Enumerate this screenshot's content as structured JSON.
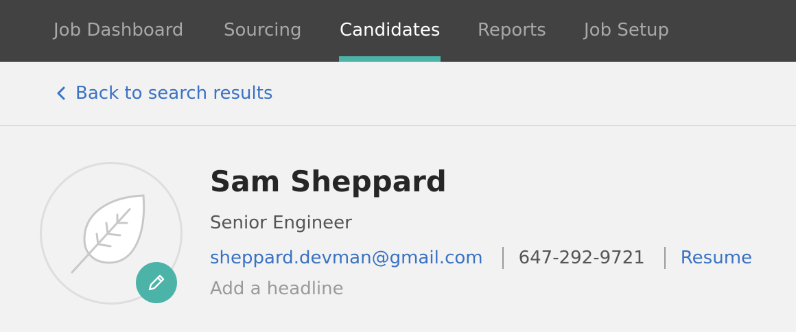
{
  "nav": {
    "tabs": [
      {
        "label": "Job Dashboard"
      },
      {
        "label": "Sourcing"
      },
      {
        "label": "Candidates",
        "active": true
      },
      {
        "label": "Reports"
      },
      {
        "label": "Job Setup"
      }
    ]
  },
  "back_link": {
    "label": "Back to search results",
    "icon": "chevron-left-icon"
  },
  "candidate": {
    "name": "Sam Sheppard",
    "title": "Senior Engineer",
    "email": "sheppard.devman@gmail.com",
    "phone": "647-292-9721",
    "resume_label": "Resume",
    "headline_placeholder": "Add a headline",
    "avatar_icon": "leaf-icon",
    "edit_icon": "pencil-icon"
  },
  "colors": {
    "nav_bg": "#424242",
    "accent": "#4bb3a8",
    "link": "#3a72c4",
    "page_bg": "#f2f2f2"
  }
}
